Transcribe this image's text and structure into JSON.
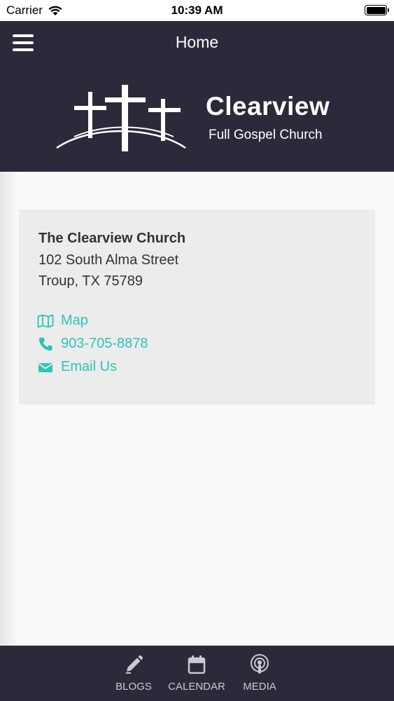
{
  "status_bar": {
    "carrier": "Carrier",
    "time": "10:39 AM"
  },
  "nav": {
    "title": "Home"
  },
  "logo": {
    "name": "Clearview",
    "subtitle": "Full Gospel Church"
  },
  "contact": {
    "church_name": "The Clearview Church",
    "address_line1": "102 South Alma Street",
    "address_line2": "Troup, TX 75789",
    "map_label": "Map",
    "phone_label": "903-705-8878",
    "email_label": "Email Us"
  },
  "tabs": [
    {
      "label": "BLOGS",
      "icon": "pencil-icon"
    },
    {
      "label": "CALENDAR",
      "icon": "calendar-icon"
    },
    {
      "label": "MEDIA",
      "icon": "podcast-icon"
    }
  ],
  "colors": {
    "nav_bg": "#2b2a3a",
    "accent": "#2ec4b6",
    "card_bg": "#ececec"
  }
}
